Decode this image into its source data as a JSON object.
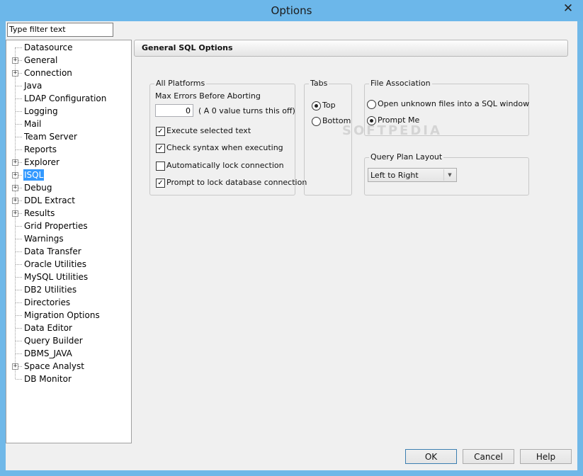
{
  "window": {
    "title": "Options",
    "close_glyph": "✕"
  },
  "filter": {
    "value": "Type filter text"
  },
  "tree": {
    "items": [
      {
        "label": "Datasource",
        "expandable": false
      },
      {
        "label": "General",
        "expandable": true
      },
      {
        "label": "Connection",
        "expandable": true
      },
      {
        "label": "Java",
        "expandable": false
      },
      {
        "label": "LDAP Configuration",
        "expandable": false
      },
      {
        "label": "Logging",
        "expandable": false
      },
      {
        "label": "Mail",
        "expandable": false
      },
      {
        "label": "Team Server",
        "expandable": false
      },
      {
        "label": "Reports",
        "expandable": false
      },
      {
        "label": "Explorer",
        "expandable": true
      },
      {
        "label": "ISQL",
        "expandable": true,
        "selected": true
      },
      {
        "label": "Debug",
        "expandable": true
      },
      {
        "label": "DDL Extract",
        "expandable": true
      },
      {
        "label": "Results",
        "expandable": true
      },
      {
        "label": "Grid Properties",
        "expandable": false
      },
      {
        "label": "Warnings",
        "expandable": false
      },
      {
        "label": "Data Transfer",
        "expandable": false
      },
      {
        "label": "Oracle Utilities",
        "expandable": false
      },
      {
        "label": "MySQL Utilities",
        "expandable": false
      },
      {
        "label": "DB2 Utilities",
        "expandable": false
      },
      {
        "label": "Directories",
        "expandable": false
      },
      {
        "label": "Migration Options",
        "expandable": false
      },
      {
        "label": "Data Editor",
        "expandable": false
      },
      {
        "label": "Query Builder",
        "expandable": false
      },
      {
        "label": "DBMS_JAVA",
        "expandable": false
      },
      {
        "label": "Space Analyst",
        "expandable": true
      },
      {
        "label": "DB Monitor",
        "expandable": false
      }
    ]
  },
  "panel": {
    "title": "General SQL Options",
    "all_platforms": {
      "title": "All Platforms",
      "max_errors_label": "Max Errors Before Aborting",
      "max_errors_value": "0",
      "max_errors_hint": "( A 0 value turns this off)",
      "checkboxes": [
        {
          "label": "Execute selected text",
          "checked": true
        },
        {
          "label": "Check syntax when executing",
          "checked": true
        },
        {
          "label": "Automatically lock connection",
          "checked": false
        },
        {
          "label": "Prompt to lock database connection",
          "checked": true
        }
      ]
    },
    "tabs": {
      "title": "Tabs",
      "options": [
        {
          "label": "Top",
          "selected": true
        },
        {
          "label": "Bottom",
          "selected": false
        }
      ]
    },
    "file_association": {
      "title": "File Association",
      "options": [
        {
          "label": "Open unknown files into a SQL window",
          "selected": false
        },
        {
          "label": "Prompt Me",
          "selected": true
        }
      ]
    },
    "query_plan_layout": {
      "title": "Query Plan Layout",
      "selected": "Left to Right"
    }
  },
  "buttons": {
    "ok": "OK",
    "cancel": "Cancel",
    "help": "Help"
  },
  "watermark": "SOFTPEDIA"
}
